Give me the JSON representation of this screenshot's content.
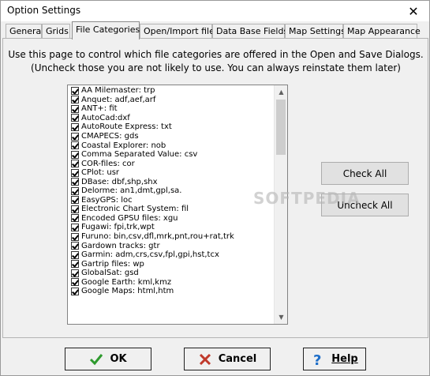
{
  "window": {
    "title": "Option Settings"
  },
  "tabs": [
    {
      "label": "General"
    },
    {
      "label": "Grids"
    },
    {
      "label": "File Categories"
    },
    {
      "label": "Open/Import files"
    },
    {
      "label": "Data Base Fields"
    },
    {
      "label": "Map Settings"
    },
    {
      "label": "Map Appearance"
    }
  ],
  "active_tab": "File Categories",
  "description": {
    "line1": "Use this page to control which file categories are offered in the Open and Save Dialogs.",
    "line2": "(Uncheck those you are not likely to use. You can always reinstate them later)"
  },
  "file_categories": [
    {
      "label": "AA Milemaster: trp",
      "checked": true
    },
    {
      "label": "Anquet: adf,aef,arf",
      "checked": true
    },
    {
      "label": "ANT+: fit",
      "checked": true
    },
    {
      "label": "AutoCad:dxf",
      "checked": true
    },
    {
      "label": "AutoRoute Express: txt",
      "checked": true
    },
    {
      "label": "CMAPECS: gds",
      "checked": true
    },
    {
      "label": "Coastal Explorer: nob",
      "checked": true
    },
    {
      "label": "Comma Separated Value: csv",
      "checked": true
    },
    {
      "label": "COR-files: cor",
      "checked": true
    },
    {
      "label": "CPlot: usr",
      "checked": true
    },
    {
      "label": "DBase: dbf,shp,shx",
      "checked": true
    },
    {
      "label": "Delorme: an1,dmt,gpl,sa.",
      "checked": true
    },
    {
      "label": "EasyGPS: loc",
      "checked": true
    },
    {
      "label": "Electronic Chart System: fil",
      "checked": true
    },
    {
      "label": "Encoded GPSU files: xgu",
      "checked": true
    },
    {
      "label": "Fugawi: fpi,trk,wpt",
      "checked": true
    },
    {
      "label": "Furuno: bin,csv,dfl,mrk,pnt,rou+rat,trk",
      "checked": true
    },
    {
      "label": "Gardown tracks: gtr",
      "checked": true
    },
    {
      "label": "Garmin: adm,crs,csv,fpl,gpi,hst,tcx",
      "checked": true
    },
    {
      "label": "Gartrip files: wp",
      "checked": true
    },
    {
      "label": "GlobalSat: gsd",
      "checked": true
    },
    {
      "label": "Google Earth: kml,kmz",
      "checked": true
    },
    {
      "label": "Google Maps: html,htm",
      "checked": true
    }
  ],
  "buttons": {
    "check_all": "Check All",
    "uncheck_all": "Uncheck All",
    "ok": "OK",
    "cancel": "Cancel",
    "help": "Help"
  },
  "icons": {
    "close": "close-icon",
    "ok": "check-mark-icon",
    "cancel": "cross-icon",
    "help": "question-mark-icon",
    "scroll_up": "scroll-up-arrow-icon",
    "scroll_down": "scroll-down-arrow-icon"
  },
  "colors": {
    "ok_icon": "#2e9a2e",
    "cancel_icon": "#c0392b",
    "help_icon": "#1e6ec8"
  },
  "watermark": "SOFTPEDIA"
}
